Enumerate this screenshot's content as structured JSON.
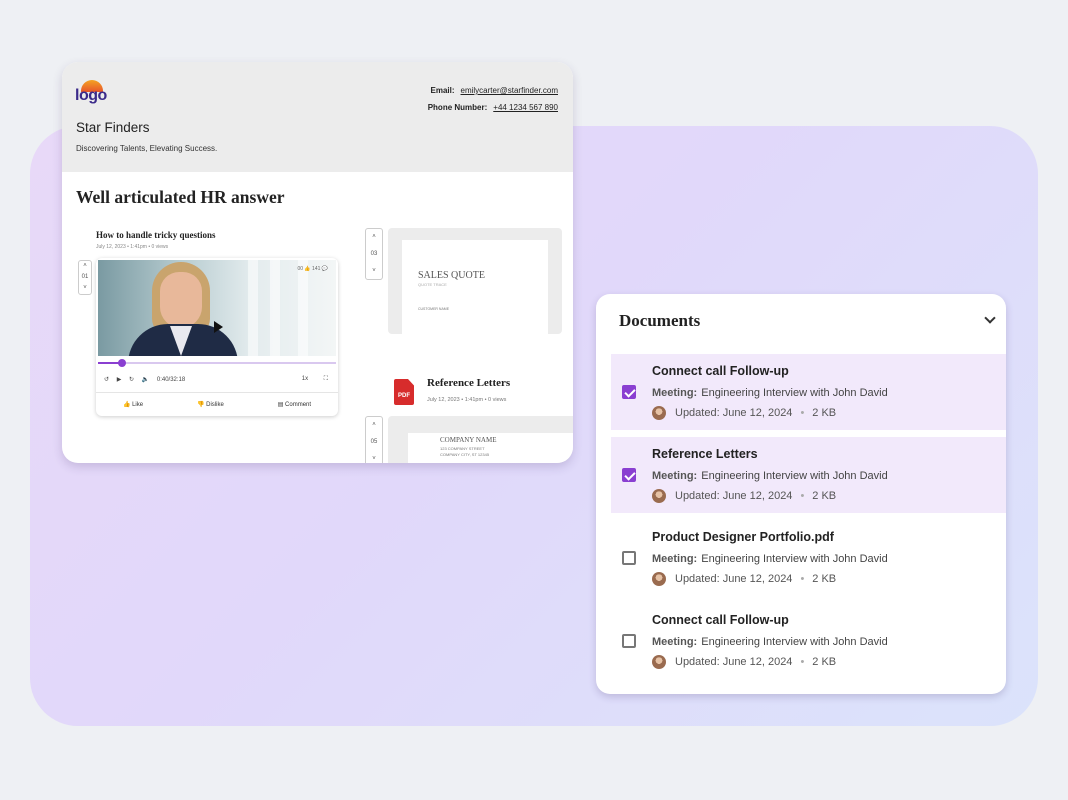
{
  "profile": {
    "logo": "logo",
    "email_label": "Email:",
    "email": "emilycarter@starfinder.com",
    "phone_label": "Phone Number:",
    "phone": "+44 1234 567 890",
    "company": "Star Finders",
    "tagline": "Discovering Talents, Elevating Success."
  },
  "main": {
    "title": "Well articulated HR answer",
    "video": {
      "title": "How to handle tricky questions",
      "meta": "July 12, 2023  •  1:41pm  •  0 views",
      "index": "01",
      "time": "0:40/32:18",
      "speed": "1x",
      "stats": "00 👍  141 💬",
      "progress": 0.1,
      "actions": [
        "Like",
        "Dislike",
        "Comment"
      ]
    },
    "quote": {
      "index": "03",
      "title": "SALES QUOTE",
      "subtitle": "QUOTE TRACE",
      "customer": "CUSTOMER NAME"
    },
    "ref": {
      "title": "Reference Letters",
      "meta": "July 12, 2023  •  1:41pm  •  0 views",
      "pdf": "PDF",
      "index": "05",
      "company": "COMPANY NAME",
      "street": "123 COMPANY STREET",
      "city": "COMPANY CITY, ST 12345"
    }
  },
  "documents": {
    "title": "Documents",
    "meeting_label": "Meeting:",
    "items": [
      {
        "name": "Connect call Follow-up",
        "meeting": "Engineering Interview with John David",
        "updated": "Updated: June 12, 2024",
        "size": "2 KB",
        "checked": true
      },
      {
        "name": "Reference Letters",
        "meeting": "Engineering Interview with John David",
        "updated": "Updated: June 12, 2024",
        "size": "2 KB",
        "checked": true
      },
      {
        "name": "Product Designer Portfolio.pdf",
        "meeting": "Engineering Interview with John David",
        "updated": "Updated: June 12, 2024",
        "size": "2 KB",
        "checked": false
      },
      {
        "name": "Connect call Follow-up",
        "meeting": "Engineering Interview with John David",
        "updated": "Updated: June 12, 2024",
        "size": "2 KB",
        "checked": false
      }
    ]
  },
  "colors": {
    "accent": "#8a3fd1",
    "selected_bg": "#f2e9fb"
  }
}
